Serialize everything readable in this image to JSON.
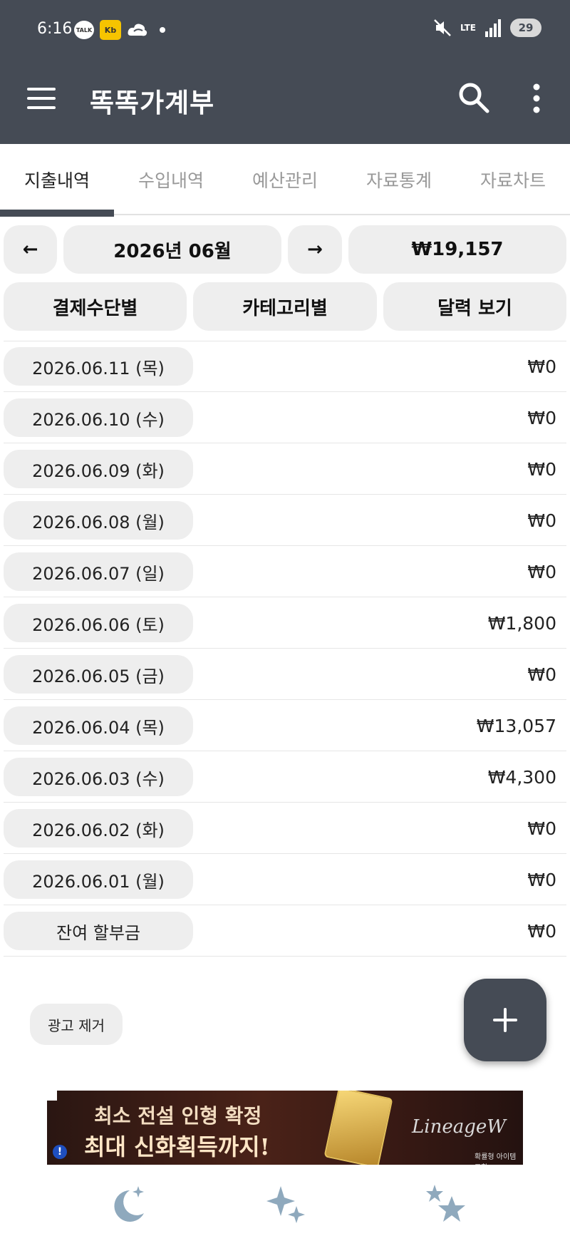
{
  "status_bar": {
    "time": "6:16",
    "talk_label": "TALK",
    "kb_label": "Kb",
    "network": "LTE",
    "battery": "29"
  },
  "app_bar": {
    "title": "똑똑가계부",
    "icons": [
      "menu-icon",
      "search-icon",
      "more-vert-icon"
    ]
  },
  "tabs": [
    {
      "label": "지출내역",
      "active": true
    },
    {
      "label": "수입내역",
      "active": false
    },
    {
      "label": "예산관리",
      "active": false
    },
    {
      "label": "자료통계",
      "active": false
    },
    {
      "label": "자료차트",
      "active": false
    }
  ],
  "controls": {
    "prev_label": "←",
    "month_label": "2026년 06월",
    "next_label": "→",
    "total_label": "₩19,157",
    "by_payment_label": "결제수단별",
    "by_category_label": "카테고리별",
    "calendar_label": "달력 보기"
  },
  "rows": [
    {
      "date": "2026.06.11 (목)",
      "amount": "₩0"
    },
    {
      "date": "2026.06.10 (수)",
      "amount": "₩0"
    },
    {
      "date": "2026.06.09 (화)",
      "amount": "₩0"
    },
    {
      "date": "2026.06.08 (월)",
      "amount": "₩0"
    },
    {
      "date": "2026.06.07 (일)",
      "amount": "₩0"
    },
    {
      "date": "2026.06.06 (토)",
      "amount": "₩1,800"
    },
    {
      "date": "2026.06.05 (금)",
      "amount": "₩0"
    },
    {
      "date": "2026.06.04 (목)",
      "amount": "₩13,057"
    },
    {
      "date": "2026.06.03 (수)",
      "amount": "₩4,300"
    },
    {
      "date": "2026.06.02 (화)",
      "amount": "₩0"
    },
    {
      "date": "2026.06.01 (월)",
      "amount": "₩0"
    },
    {
      "date": "잔여 할부금",
      "amount": "₩0"
    }
  ],
  "remove_ads_label": "광고 제거",
  "fab_label": "+",
  "ad": {
    "line1": "최소 전설 인형 확정",
    "line2": "최대 신화획득까지!",
    "logo": "LineageW",
    "small": "확률형 아이템 포함",
    "info": "!"
  },
  "bottom_nav": [
    "moon-icon",
    "sparkle-icon",
    "stars-icon"
  ],
  "colors": {
    "primary": "#454b55",
    "chip_bg": "#eeeeee"
  }
}
